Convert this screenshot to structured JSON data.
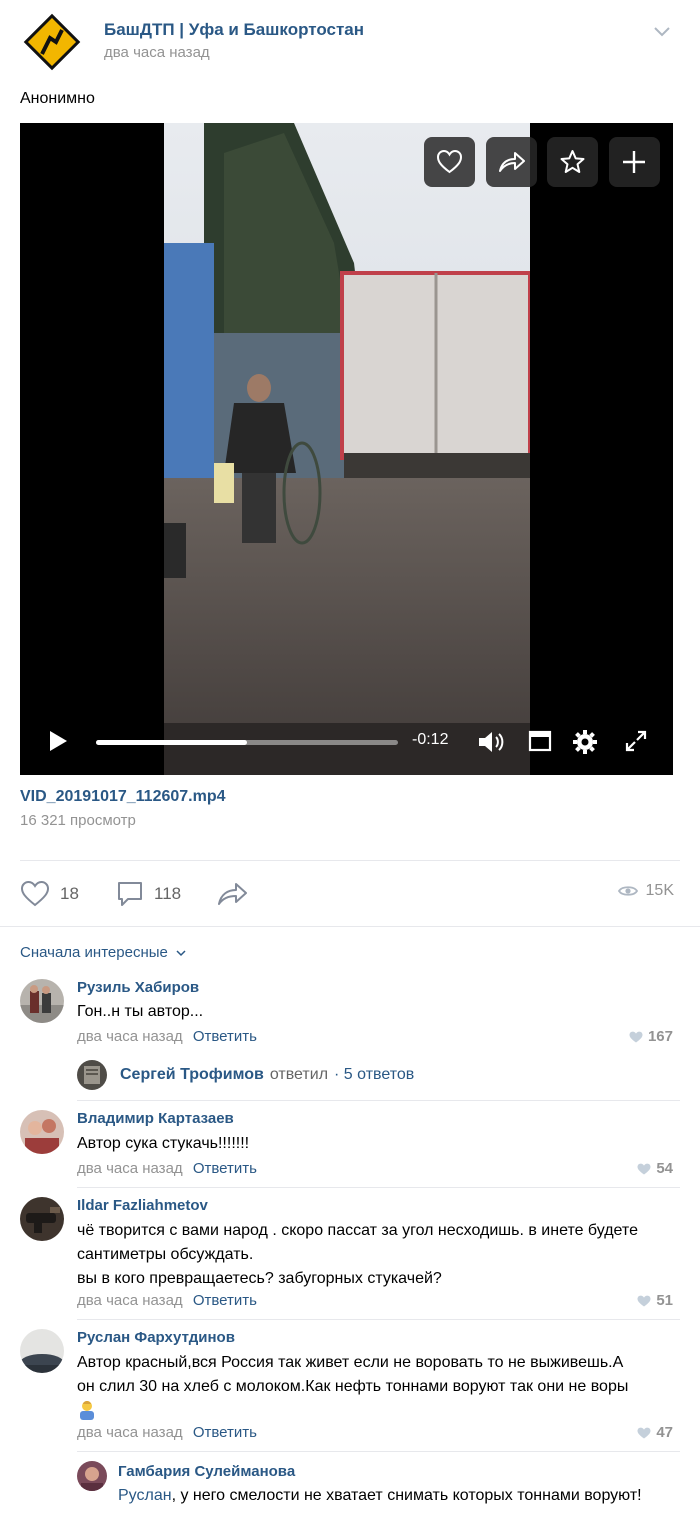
{
  "post": {
    "group_name": "БашДТП | Уфа и Башкортостан",
    "time": "два часа назад",
    "text": "Анонимно"
  },
  "video": {
    "remaining_time": "-0:12",
    "progress_fraction": 0.5,
    "file_name": "VID_20191017_112607.mp4",
    "views": "16 321 просмотр"
  },
  "actions": {
    "likes": "18",
    "comments": "118",
    "views": "15K"
  },
  "comments_sort": "Сначала интересные",
  "comments": [
    {
      "author": "Рузиль Хабиров",
      "text": "Гон..н ты автор...",
      "time": "два часа назад",
      "reply": "Ответить",
      "likes": "167",
      "thread": {
        "author": "Сергей Трофимов",
        "verb": "ответил",
        "count": "· 5 ответов"
      }
    },
    {
      "author": "Владимир Картазаев",
      "text": "Автор сука стукачь!!!!!!!",
      "time": "два часа назад",
      "reply": "Ответить",
      "likes": "54"
    },
    {
      "author": "Ildar Fazliahmetov",
      "text_lines": [
        "чё творится с вами народ . скоро пассат за угол несходишь. в инете будете",
        "сантиметры обсуждать.",
        "вы в кого превращаетесь? забугорных стукачей?"
      ],
      "time": "два часа назад",
      "reply": "Ответить",
      "likes": "51"
    },
    {
      "author": "Руслан Фархутдинов",
      "text_lines": [
        "Автор красный,вся Россия так живет если не воровать то не выживешь.А",
        "он слил 30 на хлеб с молоком.Как нефть тоннами воруют так они не воры"
      ],
      "time": "два часа назад",
      "reply": "Ответить",
      "likes": "47"
    }
  ],
  "nested_reply": {
    "author": "Гамбария Сулейманова",
    "addressee": "Руслан",
    "text": ", у него смелости не хватает снимать которых тоннами воруют!"
  }
}
